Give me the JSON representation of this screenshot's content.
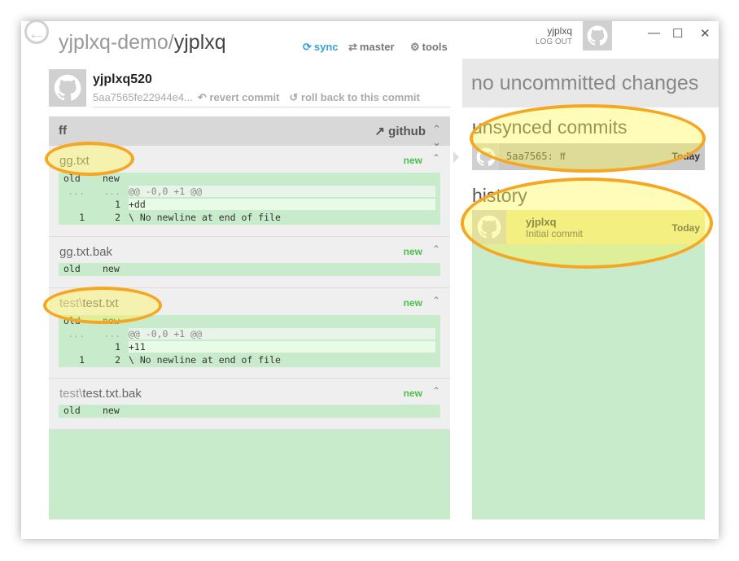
{
  "title": {
    "owner": "yjplxq-demo/",
    "repo": "yjplxq"
  },
  "nav": {
    "sync": "sync",
    "branch": "master",
    "tools": "tools"
  },
  "user": {
    "name": "yjplxq",
    "logout": "LOG OUT"
  },
  "window": {
    "minimize": "—",
    "maximize": "☐",
    "close": "✕"
  },
  "commit": {
    "author": "yjplxq520",
    "sha": "5aa7565fe22944e4...",
    "revert": "revert commit",
    "rollback": "roll back to this commit",
    "message": "ff",
    "github": "github"
  },
  "files": [
    {
      "dir": "",
      "name": "gg.txt",
      "status": "new",
      "header": {
        "old": "old",
        "new": "new"
      },
      "lines": [
        {
          "old": "...",
          "new": "...",
          "text": "@@ -0,0 +1 @@"
        },
        {
          "old": "",
          "new": "1",
          "text": "+dd"
        },
        {
          "old": "1",
          "new": "2",
          "text": "\\ No newline at end of file"
        }
      ]
    },
    {
      "dir": "",
      "name": "gg.txt.bak",
      "status": "new",
      "header": {
        "old": "old",
        "new": "new"
      }
    },
    {
      "dir": "test\\",
      "name": "test.txt",
      "status": "new",
      "header": {
        "old": "old",
        "new": "new"
      },
      "lines": [
        {
          "old": "...",
          "new": "...",
          "text": "@@ -0,0 +1 @@"
        },
        {
          "old": "",
          "new": "1",
          "text": "+11"
        },
        {
          "old": "1",
          "new": "2",
          "text": "\\ No newline at end of file"
        }
      ]
    },
    {
      "dir": "test\\",
      "name": "test.txt.bak",
      "status": "new",
      "header": {
        "old": "old",
        "new": "new"
      }
    }
  ],
  "right": {
    "uncommitted": "no uncommitted changes",
    "unsynced_title": "unsynced commits",
    "unsynced": {
      "sha": "5aa7565:",
      "message": "ff",
      "date": "Today"
    },
    "history_title": "history",
    "history": {
      "author": "yjplxq",
      "message": "Initial commit",
      "date": "Today"
    }
  },
  "colors": {
    "accent": "#3ba0d8",
    "new": "#4cc04c",
    "highlight": "#f5a623",
    "diff_bg": "#c8ebcb"
  }
}
